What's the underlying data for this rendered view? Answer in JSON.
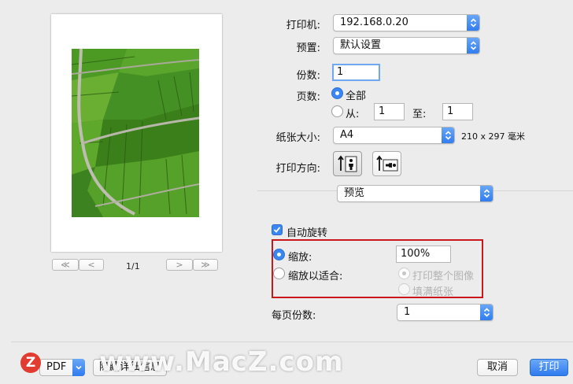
{
  "preview": {
    "page_indicator": "1/1",
    "first_label": "≪",
    "prev_label": "<",
    "next_label": ">",
    "last_label": "≫"
  },
  "printer": {
    "label": "打印机:",
    "value": "192.168.0.20"
  },
  "preset": {
    "label": "预置:",
    "value": "默认设置"
  },
  "copies": {
    "label": "份数:",
    "value": "1"
  },
  "pages": {
    "label": "页数:",
    "all_label": "全部",
    "from_label": "从:",
    "from_value": "1",
    "to_label": "至:",
    "to_value": "1"
  },
  "paper_size": {
    "label": "纸张大小:",
    "value": "A4",
    "dimensions": "210 x 297 毫米"
  },
  "orientation": {
    "label": "打印方向:"
  },
  "section": {
    "value": "预览"
  },
  "auto_rotate": {
    "label": "自动旋转"
  },
  "scale": {
    "label": "缩放:",
    "value": "100%"
  },
  "scale_to_fit": {
    "label": "缩放以适合:",
    "print_entire_label": "打印整个图像",
    "fill_paper_label": "填满纸张"
  },
  "pages_per_sheet": {
    "label": "每页份数:",
    "value": "1"
  },
  "footer": {
    "pdf_label": "PDF",
    "details_label": "隐藏详细信息",
    "cancel_label": "取消",
    "print_label": "打印"
  },
  "watermark": {
    "text": "www.MacZ.com",
    "logo": "Z"
  },
  "colors": {
    "accent": "#3a86f2",
    "highlight_box": "#c9171c"
  }
}
